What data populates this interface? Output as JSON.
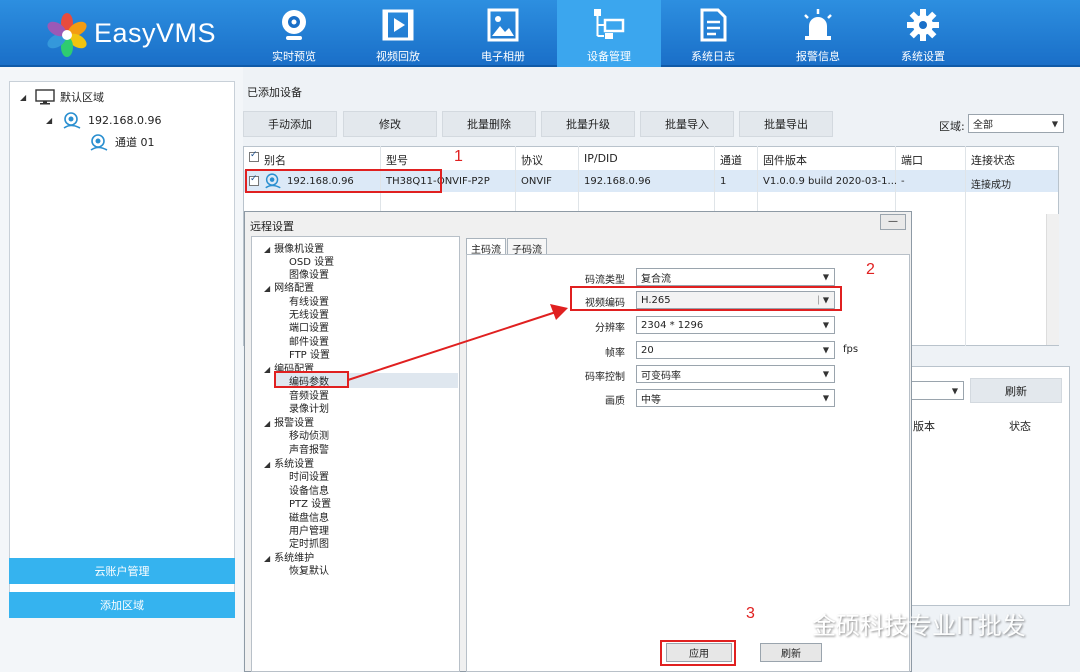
{
  "app": {
    "name": "EasyVMS"
  },
  "nav": {
    "items": [
      {
        "label": "实时预览",
        "icon": "webcam-icon"
      },
      {
        "label": "视频回放",
        "icon": "film-icon"
      },
      {
        "label": "电子相册",
        "icon": "image-icon"
      },
      {
        "label": "设备管理",
        "icon": "device-tree-icon",
        "active": true
      },
      {
        "label": "系统日志",
        "icon": "log-icon"
      },
      {
        "label": "报警信息",
        "icon": "alarm-icon"
      },
      {
        "label": "系统设置",
        "icon": "gear-icon"
      }
    ]
  },
  "sidebar": {
    "tree": {
      "root": "默认区域",
      "device": "192.168.0.96",
      "channel": "通道 01"
    },
    "cloud_button": "云账户管理",
    "add_area_button": "添加区域"
  },
  "main": {
    "section_title": "已添加设备",
    "toolbar": [
      "手动添加",
      "修改",
      "批量删除",
      "批量升级",
      "批量导入",
      "批量导出"
    ],
    "region_label": "区域:",
    "region_value": "全部",
    "table": {
      "headers": [
        "别名",
        "型号",
        "协议",
        "IP/DID",
        "通道",
        "固件版本",
        "端口",
        "连接状态"
      ],
      "rows": [
        [
          "192.168.0.96",
          "TH38Q11-ONVIF-P2P",
          "ONVIF",
          "192.168.0.96",
          "1",
          "V1.0.0.9 build 2020-03-1...",
          "-",
          "连接成功"
        ]
      ]
    },
    "lower": {
      "refresh_button": "刷新",
      "headers": [
        "版本",
        "状态"
      ]
    }
  },
  "dialog": {
    "title": "远程设置",
    "min_label": "—",
    "tree": [
      {
        "label": "摄像机设置",
        "children": [
          "OSD 设置",
          "图像设置"
        ]
      },
      {
        "label": "网络配置",
        "children": [
          "有线设置",
          "无线设置",
          "端口设置",
          "邮件设置",
          "FTP 设置"
        ]
      },
      {
        "label": "编码配置",
        "children": [
          "编码参数",
          "音频设置",
          "录像计划"
        ]
      },
      {
        "label": "报警设置",
        "children": [
          "移动侦测",
          "声音报警"
        ]
      },
      {
        "label": "系统设置",
        "children": [
          "时间设置",
          "设备信息",
          "PTZ 设置",
          "磁盘信息",
          "用户管理",
          "定时抓图"
        ]
      },
      {
        "label": "系统维护",
        "children": [
          "恢复默认"
        ]
      }
    ],
    "tabs": [
      "主码流",
      "子码流"
    ],
    "fields": [
      {
        "label": "码流类型",
        "value": "复合流"
      },
      {
        "label": "视频编码",
        "value": "H.265"
      },
      {
        "label": "分辨率",
        "value": "2304 * 1296"
      },
      {
        "label": "帧率",
        "value": "20",
        "unit": "fps"
      },
      {
        "label": "码率控制",
        "value": "可变码率"
      },
      {
        "label": "画质",
        "value": "中等"
      }
    ],
    "apply_button": "应用",
    "refresh_button": "刷新"
  },
  "annotations": {
    "step1": "1",
    "step2": "2",
    "step3": "3"
  },
  "watermark": "金硕科技专业IT批发",
  "colors": {
    "header": "#1a6fc8",
    "active_nav": "#3ba6ee",
    "sidebar_button": "#35b3ef",
    "annotation": "#e02020"
  }
}
